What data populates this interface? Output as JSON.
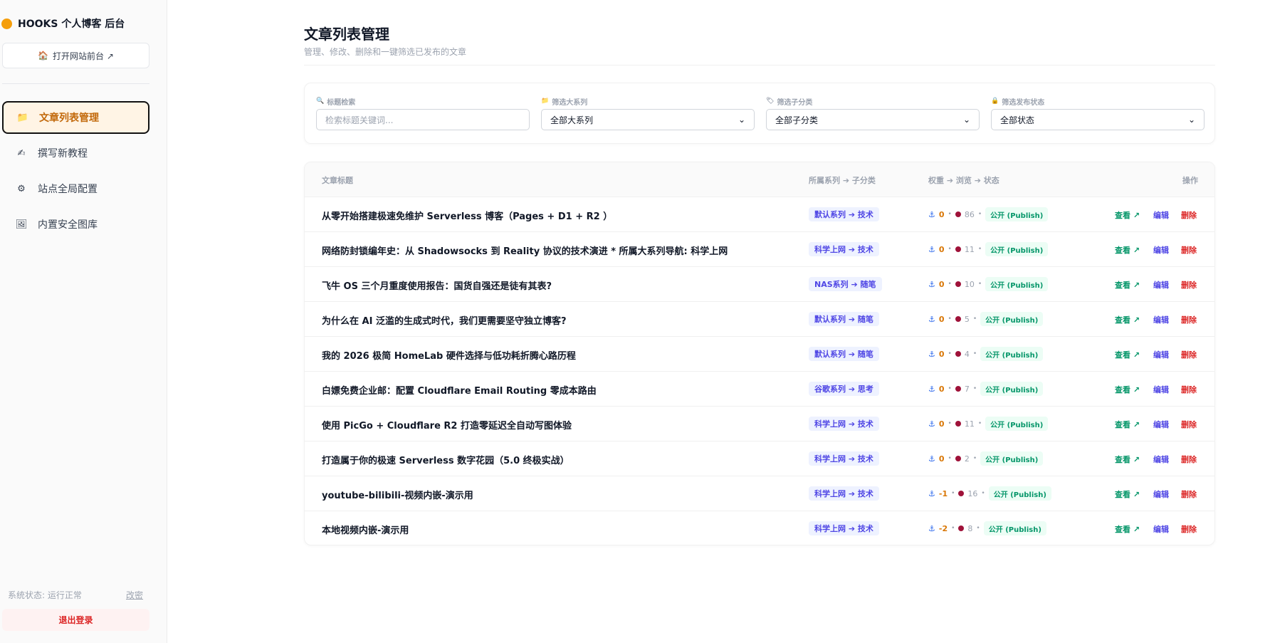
{
  "sidebar": {
    "brand": "HOOKS 个人博客 后台",
    "open_site": "打开网站前台 ↗",
    "items": [
      {
        "label": "文章列表管理",
        "icon": "📁"
      },
      {
        "label": "撰写新教程",
        "icon": "✍"
      },
      {
        "label": "站点全局配置",
        "icon": "⚙"
      },
      {
        "label": "内置安全图库",
        "icon": "🖼"
      }
    ],
    "status": "系统状态: 运行正常",
    "change": "改密",
    "logout": "退出登录"
  },
  "header": {
    "title": "文章列表管理",
    "subtitle": "管理、修改、删除和一键筛选已发布的文章"
  },
  "filters": {
    "search": {
      "label": "标题检索",
      "placeholder": "检索标题关键词...",
      "icon": "🔍"
    },
    "series": {
      "label": "筛选大系列",
      "value": "全部大系列",
      "icon": "📁"
    },
    "subcat": {
      "label": "筛选子分类",
      "value": "全部子分类",
      "icon": "🏷"
    },
    "status": {
      "label": "筛选发布状态",
      "value": "全部状态",
      "icon": "🔒"
    }
  },
  "table": {
    "headers": {
      "title": "文章标题",
      "category": "所属系列 ➔ 子分类",
      "stats": "权重 ➔ 浏览 ➔ 状态",
      "actions": "操作"
    },
    "actions": {
      "view": "查看 ↗",
      "edit": "编辑",
      "delete": "删除"
    },
    "rows": [
      {
        "title": "从零开始搭建极速免维护 Serverless 博客（Pages + D1 + R2 ）",
        "category": "默认系列 ➔ 技术",
        "weight": "0",
        "views": "86",
        "status": "公开 (Publish)"
      },
      {
        "title": "网络防封锁编年史：从 Shadowsocks 到 Reality 协议的技术演进 * 所属大系列导航: 科学上网",
        "category": "科学上网 ➔ 技术",
        "weight": "0",
        "views": "11",
        "status": "公开 (Publish)"
      },
      {
        "title": "飞牛 OS 三个月重度使用报告：国货自强还是徒有其表?",
        "category": "NAS系列 ➔ 随笔",
        "weight": "0",
        "views": "10",
        "status": "公开 (Publish)"
      },
      {
        "title": "为什么在 AI 泛滥的生成式时代，我们更需要坚守独立博客?",
        "category": "默认系列 ➔ 随笔",
        "weight": "0",
        "views": "5",
        "status": "公开 (Publish)"
      },
      {
        "title": "我的 2026 极简 HomeLab 硬件选择与低功耗折腾心路历程",
        "category": "默认系列 ➔ 随笔",
        "weight": "0",
        "views": "4",
        "status": "公开 (Publish)"
      },
      {
        "title": "白嫖免费企业邮：配置 Cloudflare Email Routing 零成本路由",
        "category": "谷歌系列 ➔ 思考",
        "weight": "0",
        "views": "7",
        "status": "公开 (Publish)"
      },
      {
        "title": "使用 PicGo + Cloudflare R2 打造零延迟全自动写图体验",
        "category": "科学上网 ➔ 技术",
        "weight": "0",
        "views": "11",
        "status": "公开 (Publish)"
      },
      {
        "title": "打造属于你的极速 Serverless 数字花园（5.0 终极实战）",
        "category": "科学上网 ➔ 技术",
        "weight": "0",
        "views": "2",
        "status": "公开 (Publish)"
      },
      {
        "title": "youtube-bilibili-视频内嵌-演示用",
        "category": "科学上网 ➔ 技术",
        "weight": "-1",
        "views": "16",
        "status": "公开 (Publish)"
      },
      {
        "title": "本地视频内嵌-演示用",
        "category": "科学上网 ➔ 技术",
        "weight": "-2",
        "views": "8",
        "status": "公开 (Publish)"
      }
    ]
  }
}
